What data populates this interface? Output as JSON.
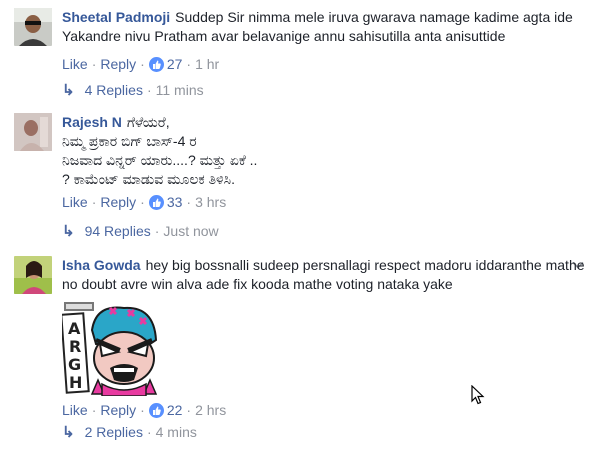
{
  "comments": [
    {
      "author": "Sheetal Padmoji",
      "text": "Suddep Sir nimma mele iruva gwarava namage kadime agta ide Yakandre nivu Pratham avar belavanige annu sahisutilla anta anisuttide",
      "like_label": "Like",
      "reply_label": "Reply",
      "like_count": "27",
      "time": "1 hr",
      "replies_label": "4 Replies",
      "replies_time": "11 mins"
    },
    {
      "author": "Rajesh N",
      "text_lines": [
        "ಗೆಳೆಯರೆ,",
        "ನಿಮ್ಮ ಪ್ರಕಾರ ಬಿಗ್ ಬಾಸ್-4 ರ",
        "ನಿಜವಾದ ವಿನ್ನರ್ ಯಾರು....? ಮತ್ತು ಏಕೆ ..",
        "? ಕಾಮೆಂಟ್ ಮಾಡುವ ಮೂಲಕ ತಿಳಿಸಿ."
      ],
      "like_label": "Like",
      "reply_label": "Reply",
      "like_count": "33",
      "time": "3 hrs",
      "replies_label": "94 Replies",
      "replies_time": "Just now"
    },
    {
      "author": "Isha Gowda",
      "text": "hey big bossnalli sudeep persnallagi respect madoru iddaranthe mathe no doubt avre win alva ade fix kooda mathe voting nataka yake",
      "sticker_text": "ARGH",
      "like_label": "Like",
      "reply_label": "Reply",
      "like_count": "22",
      "time": "2 hrs",
      "replies_label": "2 Replies",
      "replies_time": "4 mins"
    }
  ],
  "separator": "·",
  "colors": {
    "link": "#4b67a1",
    "author": "#365899",
    "muted": "#90949c",
    "like_badge": "#5890ff"
  }
}
